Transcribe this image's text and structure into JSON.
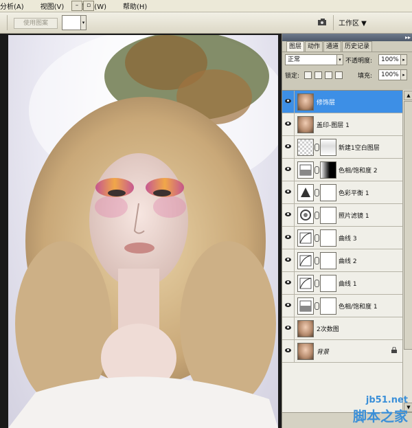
{
  "menu": {
    "items": [
      "分析(A)",
      "视图(V)",
      "窗口(W)",
      "帮助(H)"
    ],
    "partial_first": "分析"
  },
  "options_bar": {
    "use_pattern_label": "使用图案",
    "workspace_label": "工作区 ▼"
  },
  "panel": {
    "tabs": [
      "图层",
      "动作",
      "通道",
      "历史记录"
    ],
    "blend_mode": "正常",
    "opacity_label": "不透明度:",
    "opacity_value": "100%",
    "lock_label": "锁定:",
    "fill_label": "填充:",
    "fill_value": "100%",
    "layers": [
      {
        "name": "修饰层",
        "thumb": "photo",
        "mask": null,
        "selected": true
      },
      {
        "name": "盖印-图层 1",
        "thumb": "photo",
        "mask": null,
        "selected": false
      },
      {
        "name": "新建1空白图层",
        "thumb": "transparent",
        "mask": "gradient",
        "selected": false
      },
      {
        "name": "色相/饱和度 2",
        "thumb": "adjustment",
        "mask": "black-white",
        "selected": false
      },
      {
        "name": "色彩平衡 1",
        "thumb": "adjustment",
        "mask": "white",
        "selected": false
      },
      {
        "name": "照片滤镜 1",
        "thumb": "adjustment",
        "mask": "white",
        "selected": false
      },
      {
        "name": "曲线 3",
        "thumb": "adjustment",
        "mask": "white",
        "selected": false
      },
      {
        "name": "曲线 2",
        "thumb": "adjustment",
        "mask": "white",
        "selected": false
      },
      {
        "name": "曲线 1",
        "thumb": "adjustment",
        "mask": "white",
        "selected": false
      },
      {
        "name": "色相/饱和度 1",
        "thumb": "adjustment",
        "mask": "white",
        "selected": false
      },
      {
        "name": "2次数图",
        "thumb": "photo",
        "mask": null,
        "selected": false
      },
      {
        "name": "背景",
        "thumb": "photo",
        "mask": null,
        "selected": false,
        "locked": true
      }
    ]
  },
  "watermark": {
    "url": "jb51.net",
    "site": "脚本之家"
  },
  "colors": {
    "selection": "#3d8fe6",
    "chrome": "#ece9d8",
    "watermark": "#3a8fd8"
  }
}
